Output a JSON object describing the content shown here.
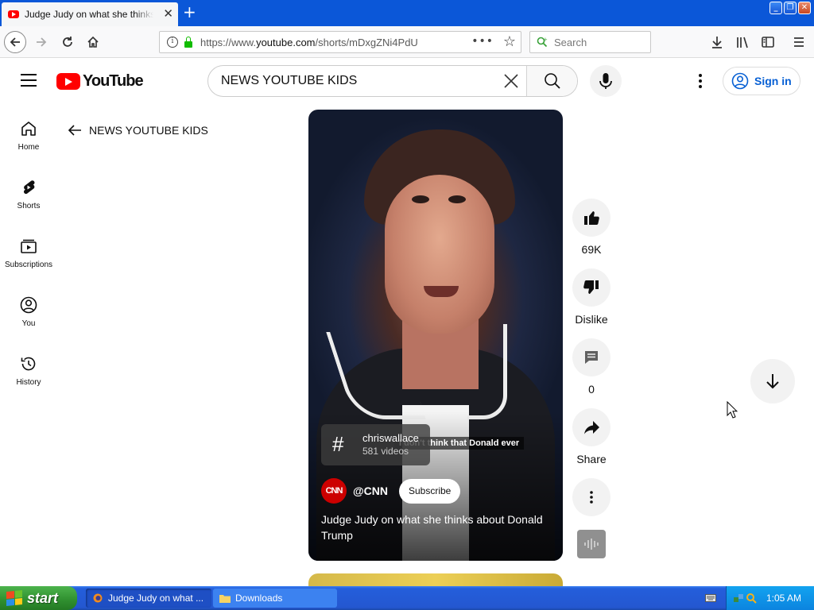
{
  "browser": {
    "tab_title": "Judge Judy on what she thinks about Donald Trump - YouTube",
    "url_prefix": "https://www.",
    "url_domain": "youtube.com",
    "url_path": "/shorts/mDxgZNi4PdU",
    "search_placeholder": "Search"
  },
  "youtube": {
    "logo_text": "YouTube",
    "search_query": "NEWS YOUTUBE KIDS",
    "signin_label": "Sign in",
    "sidebar": [
      {
        "label": "Home",
        "icon": "home-icon"
      },
      {
        "label": "Shorts",
        "icon": "shorts-icon"
      },
      {
        "label": "Subscriptions",
        "icon": "subscriptions-icon"
      },
      {
        "label": "You",
        "icon": "you-icon"
      },
      {
        "label": "History",
        "icon": "history-icon"
      }
    ],
    "back_label": "NEWS YOUTUBE KIDS"
  },
  "short": {
    "hashtag_name": "chriswallace",
    "hashtag_count": "581 videos",
    "caption_overlay": "I don't think that Donald ever",
    "channel_logo": "CNN",
    "channel_handle": "@CNN",
    "subscribe_label": "Subscribe",
    "title": "Judge Judy on what she thinks about Donald Trump",
    "likes": "69K",
    "dislike_label": "Dislike",
    "comments": "0",
    "share_label": "Share"
  },
  "taskbar": {
    "start_label": "start",
    "tasks": [
      "Judge Judy on what ...",
      "Downloads"
    ],
    "clock": "1:05 AM"
  },
  "colors": {
    "youtube_red": "#ff0000",
    "signin_blue": "#065fd4",
    "xp_taskbar": "#245edb",
    "xp_start": "#2f8f2f"
  }
}
